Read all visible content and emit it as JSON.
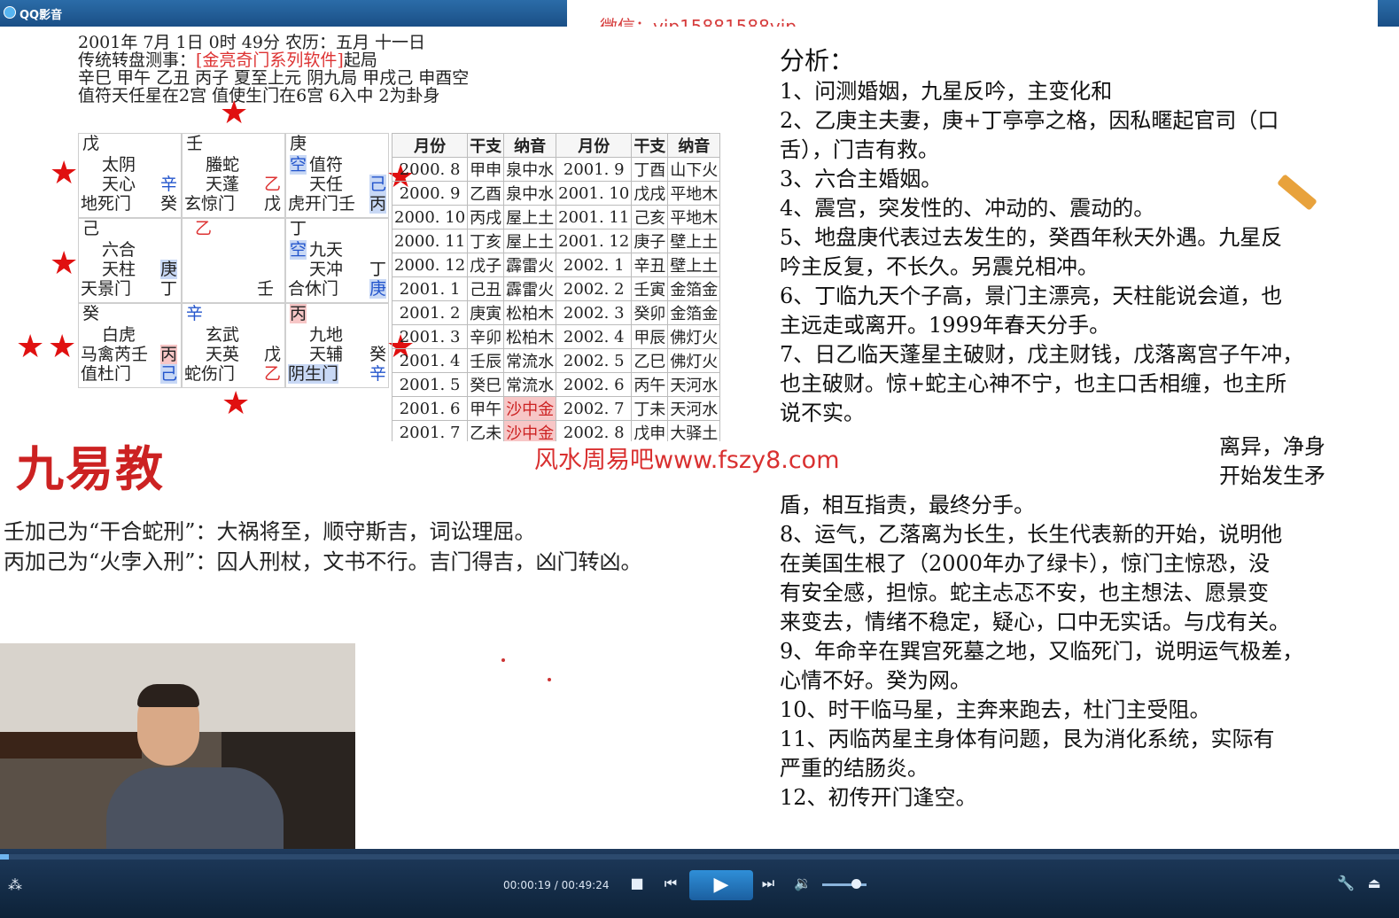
{
  "app": {
    "title": "QQ影音"
  },
  "overlay": {
    "wechat": "微信：vip15881588vip",
    "watermark": "风水周易吧www.fszy8.com",
    "big_red": "九易教"
  },
  "chart_header": {
    "line1": "2001年 7月 1日 0时 49分 农历：五月 十一日",
    "line2a": "传统转盘测事：",
    "line2b": "[金亮奇门系列软件]",
    "line2c": "起局",
    "line3": "辛巳 甲午 乙丑 丙子 夏至上元 阴九局 甲戌己 申酉空",
    "line4": "值符天任星在2宫 值使生门在6宫 6入中 2为卦身"
  },
  "palaces": [
    {
      "l1": "戊",
      "l2": "太阴",
      "l3a": "天心",
      "l3b": "辛",
      "l4a": "地死门",
      "l4b": "癸"
    },
    {
      "l1": "壬",
      "l2": "螣蛇",
      "l3a": "天蓬",
      "l3b": "乙",
      "l4a": "玄惊门",
      "l4b": "戊"
    },
    {
      "l1": "庚",
      "l2a": "空",
      "l2": "值符",
      "l3a": "天任",
      "l3b": "己",
      "l4a": "虎开门壬",
      "l4b": "丙"
    },
    {
      "l1": "己",
      "l2": "六合",
      "l3a": "天柱",
      "l3b": "庚",
      "l4a": "天景门",
      "l4b": "丁"
    },
    {
      "l1": "乙",
      "l2": "",
      "l3a": "",
      "l3b": "",
      "l4a": "",
      "l4b": "壬"
    },
    {
      "l1": "丁",
      "l2a": "空",
      "l2": "九天",
      "l3a": "天冲",
      "l3b": "丁",
      "l4a": "合休门",
      "l4b": "庚"
    },
    {
      "l1": "癸",
      "l2": "白虎",
      "l3a": "马禽芮壬",
      "l3b": "丙",
      "l4a": "值杜门",
      "l4b": "己"
    },
    {
      "l1": "辛",
      "l2": "玄武",
      "l3a": "天英",
      "l3b": "戊",
      "l4a": "蛇伤门",
      "l4b": "乙"
    },
    {
      "l1": "丙",
      "l2": "九地",
      "l3a": "天辅",
      "l3b": "癸",
      "l4a": "阴生门",
      "l4b": "辛"
    }
  ],
  "nayin_table": {
    "headers": [
      "月份",
      "干支",
      "纳音",
      "月份",
      "干支",
      "纳音"
    ],
    "rows": [
      [
        "2000. 8",
        "甲申",
        "泉中水",
        "2001. 9",
        "丁酉",
        "山下火"
      ],
      [
        "2000. 9",
        "乙酉",
        "泉中水",
        "2001. 10",
        "戊戌",
        "平地木"
      ],
      [
        "2000. 10",
        "丙戌",
        "屋上土",
        "2001. 11",
        "己亥",
        "平地木"
      ],
      [
        "2000. 11",
        "丁亥",
        "屋上土",
        "2001. 12",
        "庚子",
        "壁上土"
      ],
      [
        "2000. 12",
        "戊子",
        "霹雷火",
        "2002. 1",
        "辛丑",
        "壁上土"
      ],
      [
        "2001. 1",
        "己丑",
        "霹雷火",
        "2002. 2",
        "壬寅",
        "金箔金"
      ],
      [
        "2001. 2",
        "庚寅",
        "松柏木",
        "2002. 3",
        "癸卯",
        "金箔金"
      ],
      [
        "2001. 3",
        "辛卯",
        "松柏木",
        "2002. 4",
        "甲辰",
        "佛灯火"
      ],
      [
        "2001. 4",
        "壬辰",
        "常流水",
        "2002. 5",
        "乙巳",
        "佛灯火"
      ],
      [
        "2001. 5",
        "癸巳",
        "常流水",
        "2002. 6",
        "丙午",
        "天河水"
      ],
      [
        "2001. 6",
        "甲午",
        "沙中金",
        "2002. 7",
        "丁未",
        "天河水"
      ],
      [
        "2001. 7",
        "乙未",
        "沙中金",
        "2002. 8",
        "戊申",
        "大驿土"
      ]
    ]
  },
  "rules": {
    "r1": "壬加己为“干合蛇刑”：大祸将至，顺守斯吉，词讼理屈。",
    "r2": "丙加己为“火孛入刑”：囚人刑杖，文书不行。吉门得吉，凶门转凶。"
  },
  "analysis": {
    "title": "分析：",
    "lines": [
      "1、问测婚姻，九星反吟，主变化和",
      "2、乙庚主夫妻，庚+丁亭亭之格，因私暱起官司（口",
      "舌），门吉有救。",
      "3、六合主婚姻。",
      "4、震宫，突发性的、冲动的、震动的。",
      "5、地盘庚代表过去发生的，癸酉年秋天外遇。九星反",
      "吟主反复，不长久。另震兑相冲。",
      "6、丁临九天个子高，景门主漂亮，天柱能说会道，也",
      "主远走或离开。1999年春天分手。",
      "7、日乙临天蓬星主破财，戊主财钱，戊落离宫子午冲，",
      "也主破财。惊+蛇主心神不宁，也主口舌相缠，也主所",
      "说不实。"
    ],
    "lines_b": [
      "离异，净身",
      "开始发生矛",
      "盾，相互指责，最终分手。",
      "8、运气，乙落离为长生，长生代表新的开始，说明他",
      "在美国生根了（2000年办了绿卡），惊门主惊恐，没",
      "有安全感，担惊。蛇主忐忑不安，也主想法、愿景变",
      "来变去，情绪不稳定，疑心，口中无实话。与戊有关。",
      "9、年命辛在巽宫死墓之地，又临死门，说明运气极差，",
      "心情不好。癸为网。",
      "10、时干临马星，主奔来跑去，杜门主受阻。",
      "11、丙临芮星主身体有问题，艮为消化系统，实际有",
      "严重的结肠炎。",
      "12、初传开门逢空。"
    ]
  },
  "player": {
    "time": "00:00:19 / 00:49:24",
    "progress": 0.0064,
    "volume": 0.75
  }
}
